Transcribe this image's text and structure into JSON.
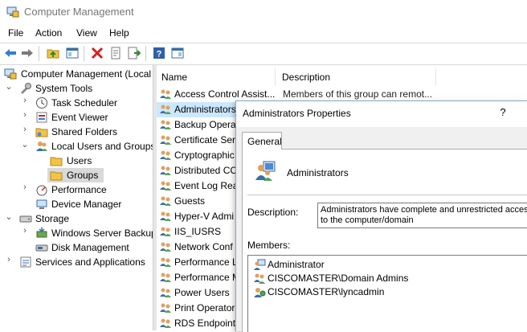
{
  "window": {
    "title": "Computer Management"
  },
  "menu": [
    "File",
    "Action",
    "View",
    "Help"
  ],
  "toolbar": {
    "buttons": [
      "back-icon",
      "forward-icon",
      "up-folder-icon",
      "show-hide-tree-icon",
      "delete-icon",
      "properties-icon",
      "export-list-icon",
      "help-icon",
      "show-hide-action-pane-icon"
    ]
  },
  "tree": {
    "root": "Computer Management (Local",
    "system_tools": "System Tools",
    "task_scheduler": "Task Scheduler",
    "event_viewer": "Event Viewer",
    "shared_folders": "Shared Folders",
    "local_users_groups": "Local Users and Groups",
    "users": "Users",
    "groups": "Groups",
    "performance": "Performance",
    "device_manager": "Device Manager",
    "storage": "Storage",
    "wsb": "Windows Server Backup",
    "disk_management": "Disk Management",
    "services_apps": "Services and Applications"
  },
  "list": {
    "columns": {
      "name": "Name",
      "description": "Description"
    },
    "rows": [
      {
        "name": "Access Control Assist...",
        "description": "Members of this group can remot..."
      },
      {
        "name": "Administrators",
        "description": ""
      },
      {
        "name": "Backup Operato",
        "description": ""
      },
      {
        "name": "Certificate Serv",
        "description": ""
      },
      {
        "name": "Cryptographic",
        "description": ""
      },
      {
        "name": "Distributed CC",
        "description": ""
      },
      {
        "name": "Event Log Rea",
        "description": ""
      },
      {
        "name": "Guests",
        "description": ""
      },
      {
        "name": "Hyper-V Admi",
        "description": ""
      },
      {
        "name": "IIS_IUSRS",
        "description": ""
      },
      {
        "name": "Network Conf",
        "description": ""
      },
      {
        "name": "Performance L",
        "description": ""
      },
      {
        "name": "Performance M",
        "description": ""
      },
      {
        "name": "Power Users",
        "description": ""
      },
      {
        "name": "Print Operator",
        "description": ""
      },
      {
        "name": "RDS Endpoint",
        "description": ""
      }
    ]
  },
  "dialog": {
    "title": "Administrators Properties",
    "help": "?",
    "tab": "General",
    "group_name": "Administrators",
    "description_label": "Description:",
    "description_line1": "Administrators have complete and unrestricted access",
    "description_line2": "to the computer/domain",
    "members_label": "Members:",
    "members": [
      "Administrator",
      "CISCOMASTER\\Domain Admins",
      "CISCOMASTER\\lyncadmin"
    ]
  },
  "colors": {
    "selection_list": "#cce8ff",
    "selection_tree": "#d9d9d9",
    "folder": "#f5c243",
    "accent": "#1e5fa8"
  }
}
